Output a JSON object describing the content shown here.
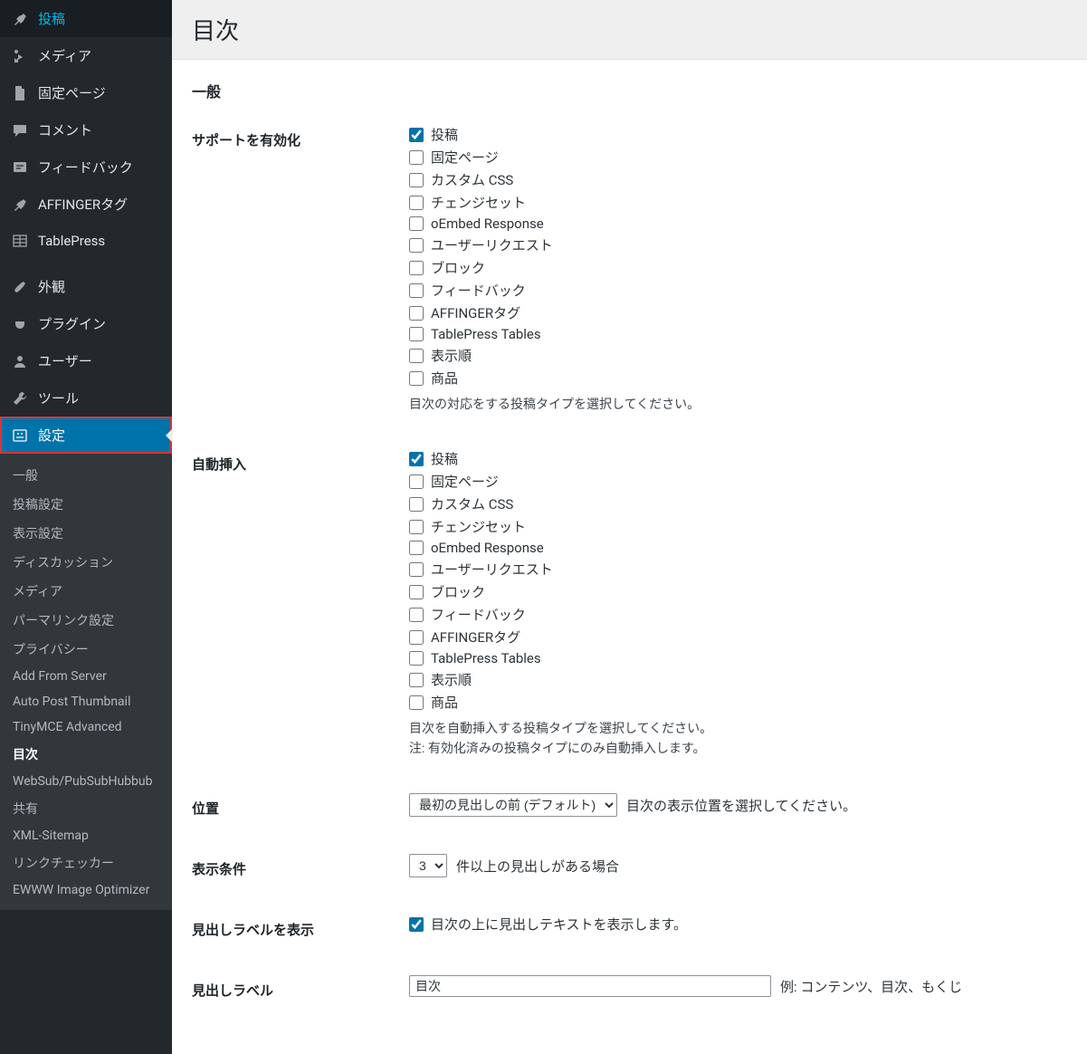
{
  "sidebar": {
    "items": [
      {
        "icon": "pin",
        "label": "投稿"
      },
      {
        "icon": "media",
        "label": "メディア"
      },
      {
        "icon": "page",
        "label": "固定ページ"
      },
      {
        "icon": "comment",
        "label": "コメント"
      },
      {
        "icon": "feedback",
        "label": "フィードバック"
      },
      {
        "icon": "pin",
        "label": "AFFINGERタグ"
      },
      {
        "icon": "table",
        "label": "TablePress"
      }
    ],
    "items2": [
      {
        "icon": "brush",
        "label": "外観"
      },
      {
        "icon": "plugin",
        "label": "プラグイン"
      },
      {
        "icon": "user",
        "label": "ユーザー"
      },
      {
        "icon": "tool",
        "label": "ツール"
      },
      {
        "icon": "settings",
        "label": "設定",
        "active": true,
        "highlight": true
      }
    ],
    "submenu": [
      "一般",
      "投稿設定",
      "表示設定",
      "ディスカッション",
      "メディア",
      "パーマリンク設定",
      "プライバシー",
      "Add From Server",
      "Auto Post Thumbnail",
      "TinyMCE Advanced",
      "目次",
      "WebSub/PubSubHubbub",
      "共有",
      "XML-Sitemap",
      "リンクチェッカー",
      "EWWW Image Optimizer"
    ],
    "submenu_current": "目次"
  },
  "page": {
    "title": "目次",
    "general_heading": "一般",
    "rows": {
      "support_label": "サポートを有効化",
      "support_items": [
        {
          "label": "投稿",
          "checked": true
        },
        {
          "label": "固定ページ"
        },
        {
          "label": "カスタム CSS"
        },
        {
          "label": "チェンジセット"
        },
        {
          "label": "oEmbed Response"
        },
        {
          "label": "ユーザーリクエスト"
        },
        {
          "label": "ブロック"
        },
        {
          "label": "フィードバック"
        },
        {
          "label": "AFFINGERタグ"
        },
        {
          "label": "TablePress Tables"
        },
        {
          "label": "表示順"
        },
        {
          "label": "商品"
        }
      ],
      "support_desc": "目次の対応をする投稿タイプを選択してください。",
      "auto_label": "自動挿入",
      "auto_items": [
        {
          "label": "投稿",
          "checked": true
        },
        {
          "label": "固定ページ"
        },
        {
          "label": "カスタム CSS"
        },
        {
          "label": "チェンジセット"
        },
        {
          "label": "oEmbed Response"
        },
        {
          "label": "ユーザーリクエスト"
        },
        {
          "label": "ブロック"
        },
        {
          "label": "フィードバック"
        },
        {
          "label": "AFFINGERタグ"
        },
        {
          "label": "TablePress Tables"
        },
        {
          "label": "表示順"
        },
        {
          "label": "商品"
        }
      ],
      "auto_desc1": "目次を自動挿入する投稿タイプを選択してください。",
      "auto_desc2": "注: 有効化済みの投稿タイプにのみ自動挿入します。",
      "position_label": "位置",
      "position_select": "最初の見出しの前 (デフォルト)",
      "position_desc": "目次の表示位置を選択してください。",
      "cond_label": "表示条件",
      "cond_select": "3",
      "cond_rest": "件以上の見出しがある場合",
      "showlabel_label": "見出しラベルを表示",
      "showlabel_text": "目次の上に見出しテキストを表示します。",
      "showlabel_checked": true,
      "headlabel_label": "見出しラベル",
      "headlabel_value": "目次",
      "headlabel_example": "例: コンテンツ、目次、もくじ"
    }
  }
}
